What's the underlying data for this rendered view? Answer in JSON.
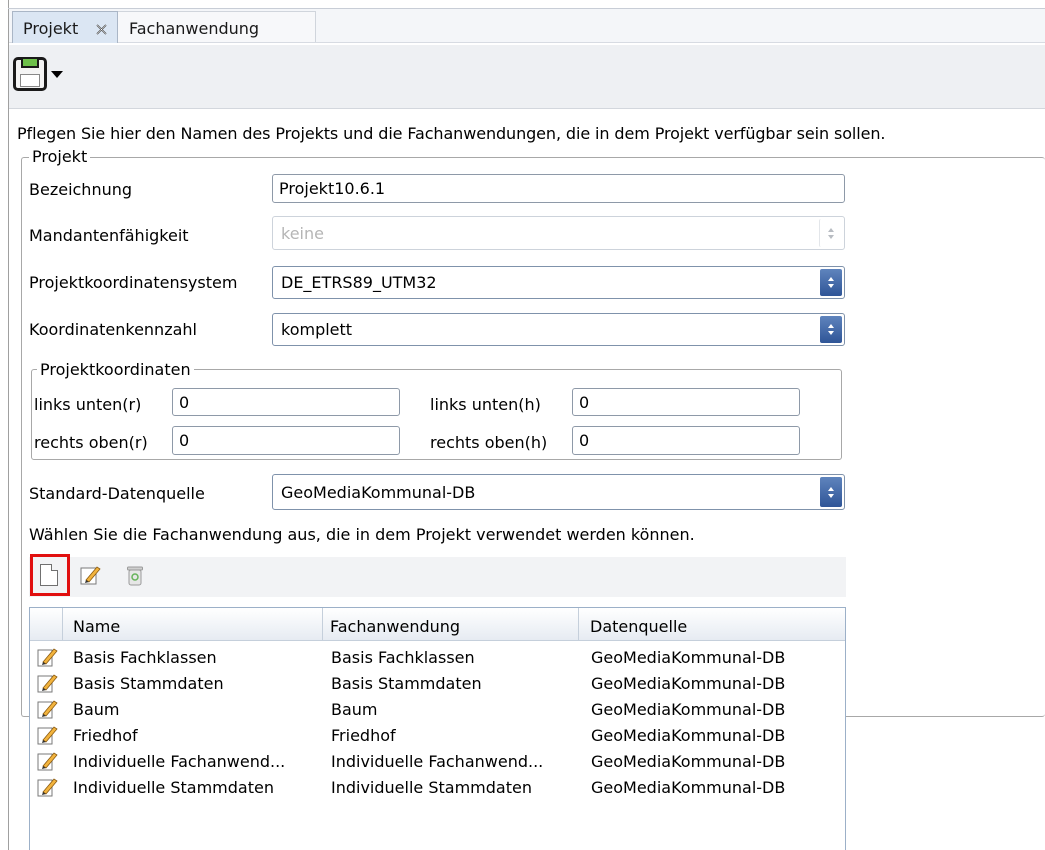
{
  "tabs": [
    {
      "label": "Projekt",
      "active": true,
      "closable": true
    },
    {
      "label": "Fachanwendung",
      "active": false
    }
  ],
  "intro_text": "Pflegen Sie hier den Namen des Projekts und die Fachanwendungen, die in dem Projekt verfügbar sein sollen.",
  "projekt_group": {
    "legend": "Projekt",
    "bezeichnung": {
      "label": "Bezeichnung",
      "value": "Projekt10.6.1"
    },
    "mandantenfaehigkeit": {
      "label": "Mandantenfähigkeit",
      "value": "keine",
      "disabled": true
    },
    "projektkoordinatensystem": {
      "label": "Projektkoordinatensystem",
      "value": "DE_ETRS89_UTM32"
    },
    "koordinatenkennzahl": {
      "label": "Koordinatenkennzahl",
      "value": "komplett"
    },
    "projektkoordinaten": {
      "legend": "Projektkoordinaten",
      "links_unten_r": {
        "label": "links unten(r)",
        "value": "0"
      },
      "links_unten_h": {
        "label": "links unten(h)",
        "value": "0"
      },
      "rechts_oben_r": {
        "label": "rechts oben(r)",
        "value": "0"
      },
      "rechts_oben_h": {
        "label": "rechts oben(h)",
        "value": "0"
      }
    },
    "standard_datenquelle": {
      "label": "Standard-Datenquelle",
      "value": "GeoMediaKommunal-DB"
    }
  },
  "fachanwendung_hint": "Wählen Sie die Fachanwendung aus, die in dem Projekt verwendet werden können.",
  "icons": {
    "save": "floppy-disk-icon",
    "new": "new-document-icon",
    "edit": "edit-pencil-icon",
    "delete": "recycle-bin-icon",
    "highlight_color": "#e10f0f"
  },
  "table": {
    "columns": [
      "Name",
      "Fachanwendung",
      "Datenquelle"
    ],
    "rows": [
      {
        "name": "Basis Fachklassen",
        "fachanwendung": "Basis Fachklassen",
        "datenquelle": "GeoMediaKommunal-DB"
      },
      {
        "name": "Basis Stammdaten",
        "fachanwendung": "Basis Stammdaten",
        "datenquelle": "GeoMediaKommunal-DB"
      },
      {
        "name": "Baum",
        "fachanwendung": "Baum",
        "datenquelle": "GeoMediaKommunal-DB"
      },
      {
        "name": "Friedhof",
        "fachanwendung": "Friedhof",
        "datenquelle": "GeoMediaKommunal-DB"
      },
      {
        "name": "Individuelle Fachanwend...",
        "fachanwendung": "Individuelle Fachanwend...",
        "datenquelle": "GeoMediaKommunal-DB"
      },
      {
        "name": "Individuelle Stammdaten",
        "fachanwendung": "Individuelle Stammdaten",
        "datenquelle": "GeoMediaKommunal-DB"
      }
    ]
  }
}
